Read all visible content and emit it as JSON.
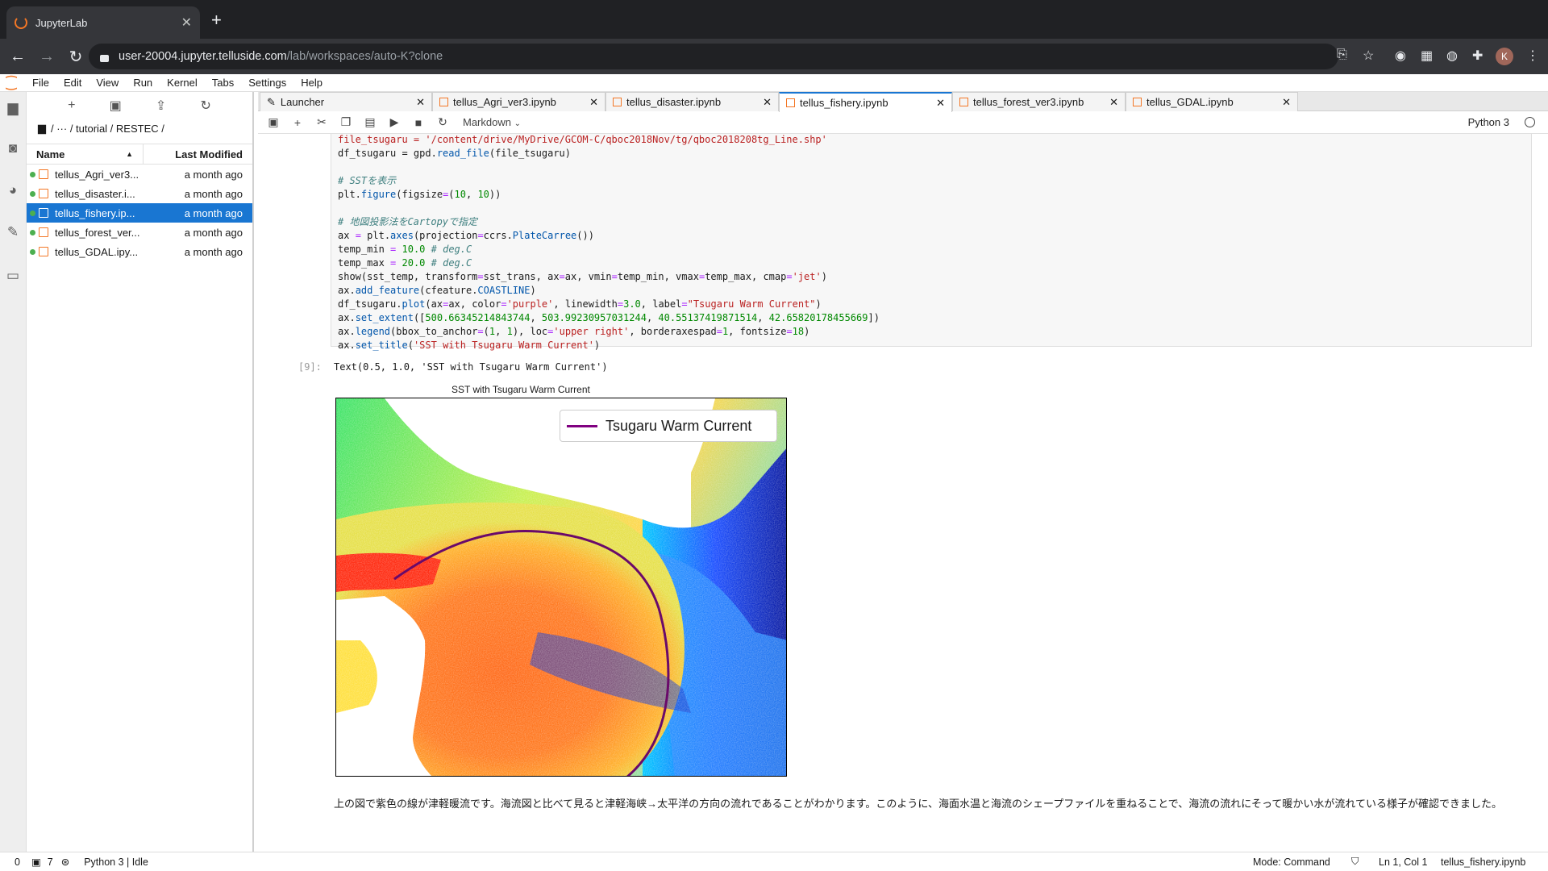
{
  "browser": {
    "tab_title": "JupyterLab",
    "url_host": "user-20004.jupyter.telluside.com",
    "url_path": "/lab/workspaces/auto-K?clone",
    "profile_initial": "K"
  },
  "menu": [
    "File",
    "Edit",
    "View",
    "Run",
    "Kernel",
    "Tabs",
    "Settings",
    "Help"
  ],
  "filebrowser": {
    "breadcrumb": "/ ··· / tutorial / RESTEC /",
    "col_name": "Name",
    "col_modified": "Last Modified",
    "files": [
      {
        "name": "tellus_Agri_ver3...",
        "modified": "a month ago"
      },
      {
        "name": "tellus_disaster.i...",
        "modified": "a month ago"
      },
      {
        "name": "tellus_fishery.ip...",
        "modified": "a month ago",
        "selected": true
      },
      {
        "name": "tellus_forest_ver...",
        "modified": "a month ago"
      },
      {
        "name": "tellus_GDAL.ipy...",
        "modified": "a month ago"
      }
    ]
  },
  "tabs": [
    {
      "label": "Launcher"
    },
    {
      "label": "tellus_Agri_ver3.ipynb"
    },
    {
      "label": "tellus_disaster.ipynb"
    },
    {
      "label": "tellus_fishery.ipynb",
      "active": true
    },
    {
      "label": "tellus_forest_ver3.ipynb"
    },
    {
      "label": "tellus_GDAL.ipynb"
    }
  ],
  "toolbar": {
    "cell_type": "Markdown",
    "kernel": "Python 3"
  },
  "output": {
    "prompt": "[9]:",
    "text": "Text(0.5, 1.0, 'SST with Tsugaru Warm Current')",
    "plot_title": "SST with Tsugaru Warm Current",
    "legend_label": "Tsugaru Warm Current",
    "legend_color": "#800080"
  },
  "markdown": "上の図で紫色の線が津軽暖流です。海流図と比べて見ると津軽海峡→太平洋の方向の流れであることがわかります。このように、海面水温と海流のシェープファイルを重ねることで、海流の流れにそって暖かい水が流れている様子が確認できました。",
  "status": {
    "left_a": "0",
    "left_b": "7",
    "kernel_state": "Python 3 | Idle",
    "mode": "Mode: Command",
    "cursor": "Ln 1, Col 1",
    "file": "tellus_fishery.ipynb"
  }
}
